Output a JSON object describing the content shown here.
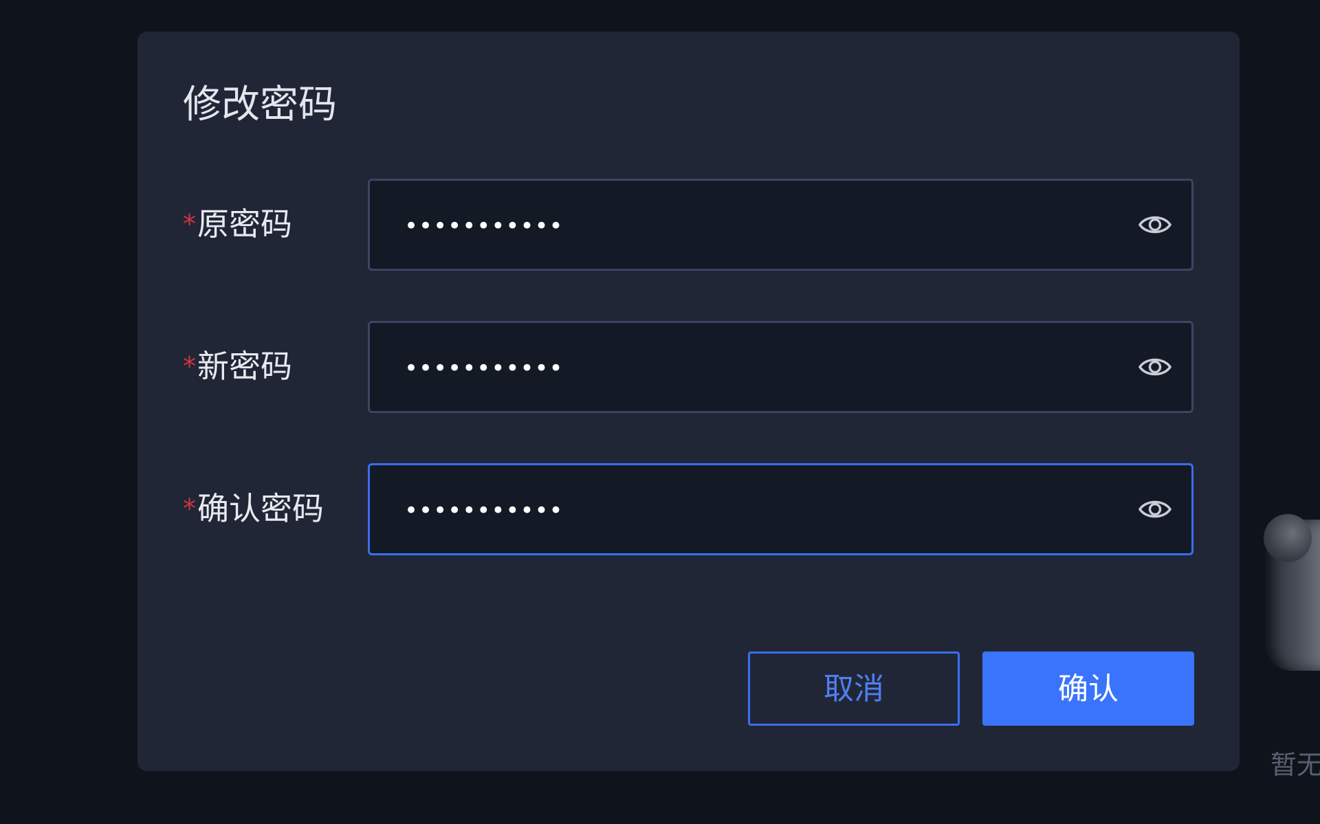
{
  "dialog": {
    "title": "修改密码",
    "required_mark": "*",
    "fields": [
      {
        "label": "原密码",
        "value": "•••••••••••",
        "focused": false,
        "icon": "eye-icon"
      },
      {
        "label": "新密码",
        "value": "•••••••••••",
        "focused": false,
        "icon": "eye-icon"
      },
      {
        "label": "确认密码",
        "value": "•••••••••••",
        "focused": true,
        "icon": "eye-icon"
      }
    ],
    "cancel_label": "取消",
    "confirm_label": "确认"
  },
  "background": {
    "empty_text": "暂无"
  },
  "colors": {
    "accent": "#3a74fc",
    "required": "#d0343e",
    "dialog_bg": "#212637",
    "input_bg": "#141926"
  }
}
